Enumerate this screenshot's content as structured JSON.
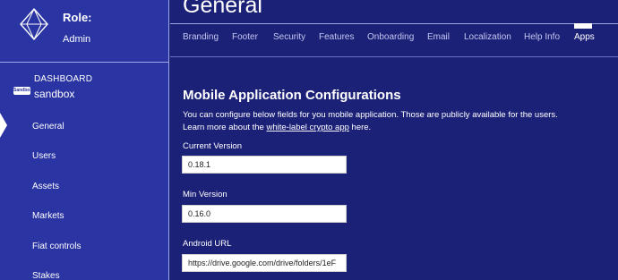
{
  "sidebar": {
    "role_label": "Role:",
    "role_value": "Admin",
    "dashboard_label": "DASHBOARD",
    "badge": "Sandbox",
    "env_name": "sandbox",
    "items": [
      {
        "label": "General",
        "active": true
      },
      {
        "label": "Users"
      },
      {
        "label": "Assets"
      },
      {
        "label": "Markets"
      },
      {
        "label": "Fiat controls"
      },
      {
        "label": "Stakes"
      }
    ]
  },
  "header": {
    "title": "General"
  },
  "tabs": [
    {
      "label": "Branding"
    },
    {
      "label": "Footer"
    },
    {
      "label": "Security"
    },
    {
      "label": "Features"
    },
    {
      "label": "Onboarding"
    },
    {
      "label": "Email"
    },
    {
      "label": "Localization"
    },
    {
      "label": "Help Info"
    },
    {
      "label": "Apps",
      "active": true
    }
  ],
  "main": {
    "section_title": "Mobile Application Configurations",
    "description_line1": "You can configure below fields for you mobile application. Those are publicly available for the users.",
    "description_line2_prefix": "Learn more about the ",
    "description_link": "white-label crypto app",
    "description_line2_suffix": " here.",
    "fields": [
      {
        "label": "Current Version",
        "value": "0.18.1"
      },
      {
        "label": "Min Version",
        "value": "0.16.0"
      },
      {
        "label": "Android URL",
        "value": "https://drive.google.com/drive/folders/1eF"
      }
    ]
  },
  "colors": {
    "main_bg": "#1c2178",
    "sidebar_bg": "#2a34a3"
  }
}
